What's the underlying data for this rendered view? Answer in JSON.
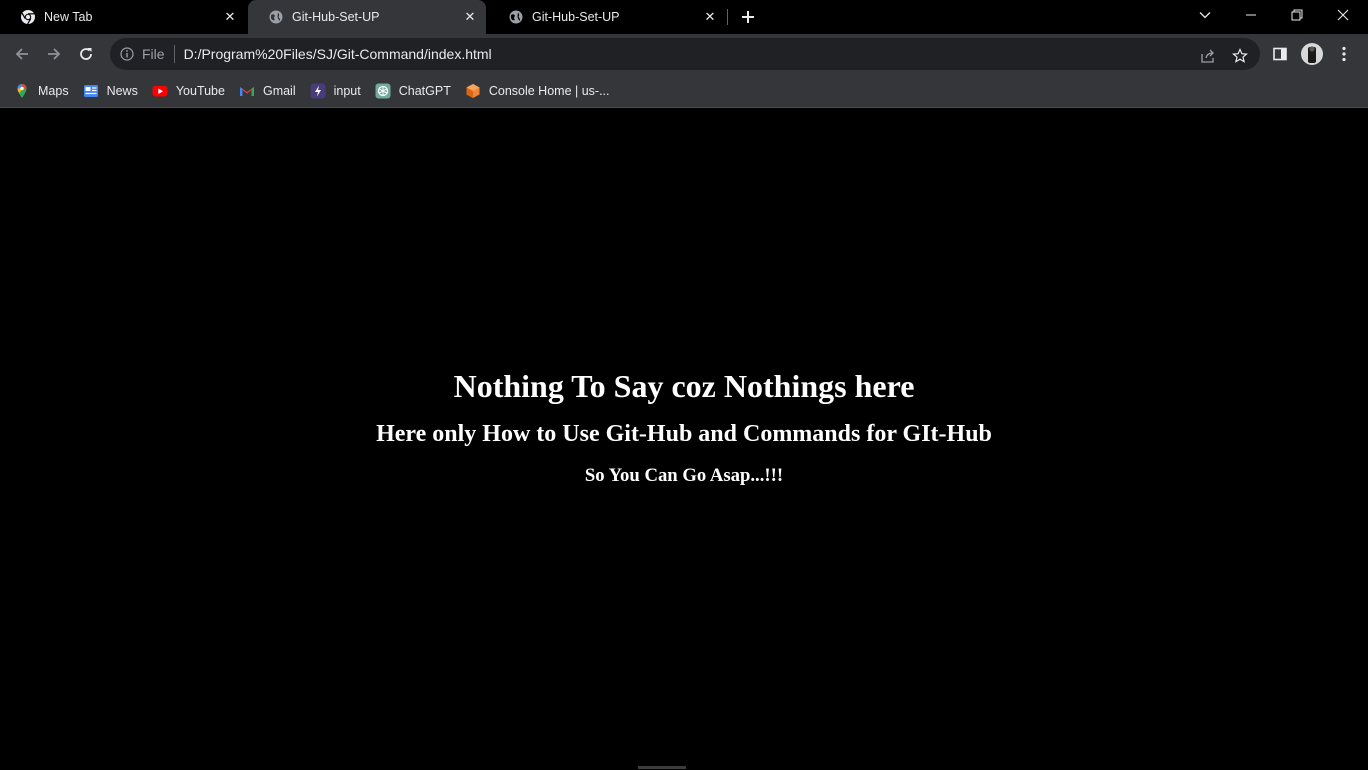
{
  "tabs": [
    {
      "title": "New Tab",
      "icon": "chrome-icon"
    },
    {
      "title": "Git-Hub-Set-UP",
      "icon": "globe-icon",
      "active": true
    },
    {
      "title": "Git-Hub-Set-UP",
      "icon": "globe-icon"
    }
  ],
  "toolbar": {
    "scheme_label": "File",
    "url": "D:/Program%20Files/SJ/Git-Command/index.html"
  },
  "bookmarks": [
    {
      "label": "Maps",
      "icon": "maps-icon"
    },
    {
      "label": "News",
      "icon": "news-icon"
    },
    {
      "label": "YouTube",
      "icon": "youtube-icon"
    },
    {
      "label": "Gmail",
      "icon": "gmail-icon"
    },
    {
      "label": "input",
      "icon": "input-icon"
    },
    {
      "label": "ChatGPT",
      "icon": "chatgpt-icon"
    },
    {
      "label": "Console Home | us-...",
      "icon": "aws-console-icon"
    }
  ],
  "content": {
    "heading": "Nothing To Say coz Nothings here",
    "subheading": "Here only How to Use Git-Hub and Commands for GIt-Hub",
    "note": "So You Can Go Asap...!!!"
  },
  "colors": {
    "page_background": "#000000",
    "toolbar_background": "#35363a",
    "omnibox_background": "#202124",
    "text": "#ffffff"
  }
}
